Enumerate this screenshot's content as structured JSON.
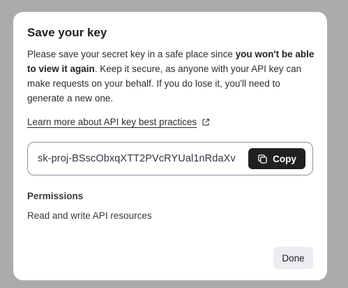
{
  "dialog": {
    "title": "Save your key",
    "description_part1": "Please save your secret key in a safe place since ",
    "description_bold": "you won't be able to view it again",
    "description_part2": ". Keep it secure, as anyone with your API key can make requests on your behalf. If you do lose it, you'll need to generate a new one.",
    "learn_more_link": "Learn more about API key best practices",
    "learn_more_icon": "external-link-icon",
    "key_value": "sk-proj-BSscObxqXTT2PVcRYUal1nRdaXv",
    "copy_button_label": "Copy",
    "copy_icon": "copy-icon",
    "permissions_label": "Permissions",
    "permissions_value": "Read and write API resources",
    "done_button_label": "Done"
  },
  "colors": {
    "backdrop": "#ababab",
    "dialog_bg": "#ffffff",
    "primary_button_bg": "#202123",
    "secondary_button_bg": "#ececf1",
    "input_border": "#8e8ea0"
  }
}
